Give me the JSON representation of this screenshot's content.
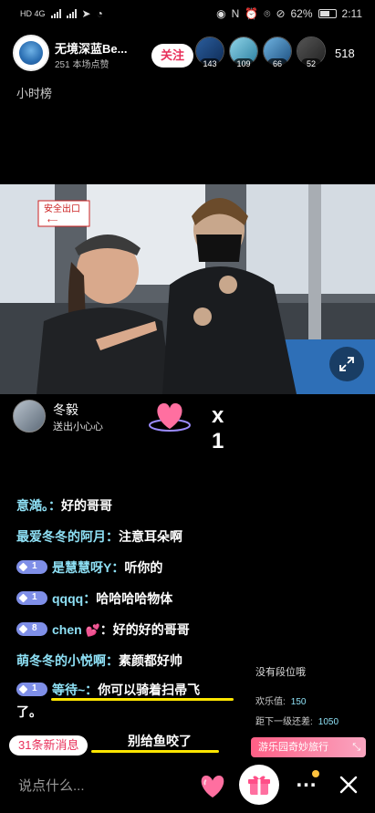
{
  "status_bar": {
    "left_network": "HD 4G",
    "battery_percent": "62%",
    "time": "2:11"
  },
  "header": {
    "anchor_name": "无境深蓝Be...",
    "anchor_likes": "251 本场点赞",
    "follow_label": "关注",
    "viewer_badges": [
      "143",
      "109",
      "66",
      "52"
    ],
    "viewer_count": "518"
  },
  "hourly_rank_label": "小时榜",
  "video": {
    "sign_text": "安全出口"
  },
  "gift_notice": {
    "sender": "冬毅",
    "text": "送出小心心",
    "count": "x 1"
  },
  "chat": [
    {
      "nick": "意澔。：",
      "msg": "好的哥哥",
      "level": ""
    },
    {
      "nick": "最爱冬冬的阿月：",
      "msg": "注意耳朵啊",
      "level": ""
    },
    {
      "nick": "是慧慧呀Y：",
      "msg": "听你的",
      "level": "1"
    },
    {
      "nick": "qqqq：",
      "msg": "哈哈哈哈物体",
      "level": "1"
    },
    {
      "nick": "chen",
      "msg": "：好的好的哥哥",
      "level": "8"
    },
    {
      "nick": "萌冬冬的小悦啊：",
      "msg": "素颜都好帅",
      "level": ""
    },
    {
      "nick": "等待~：",
      "msg": "你可以骑着扫帚飞",
      "level": "1"
    },
    {
      "nick": "",
      "msg": "了。",
      "level": ""
    },
    {
      "nick": "",
      "msg": "别给鱼咬了",
      "level": ""
    }
  ],
  "new_messages_label": "31条新消息",
  "rank_panel": {
    "title": "没有段位哦",
    "joy_label": "欢乐值:",
    "joy_value": "150",
    "next_label": "距下一级还差:",
    "next_value": "1050",
    "paradise_label": "游乐园奇妙旅行",
    "collapse_icon": "collapse-arrows-icon"
  },
  "bottom_bar": {
    "input_placeholder": "说点什么..."
  },
  "colors": {
    "accent_pink": "#e8305a",
    "nick_cyan": "#8ee0f5",
    "highlight_yellow": "#ffe600",
    "level_badge": "#7f8fe8"
  }
}
